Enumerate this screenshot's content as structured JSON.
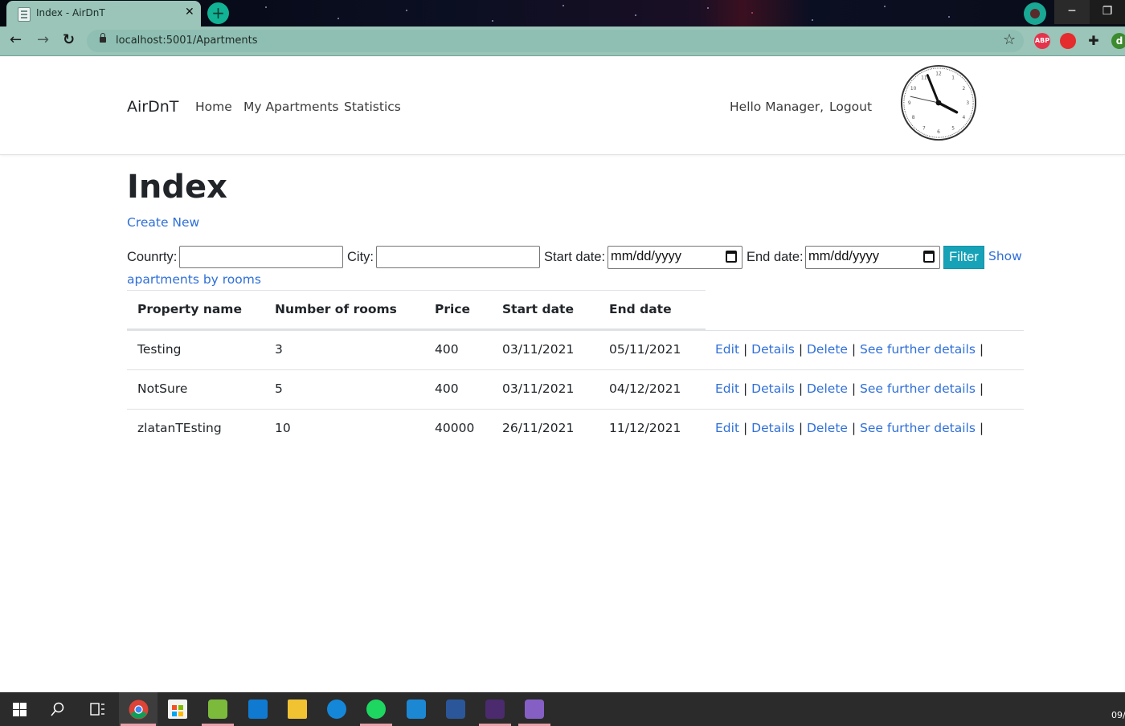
{
  "browser": {
    "tab_title": "Index - AirDnT",
    "tab_close": "✕",
    "new_tab": "+",
    "url": "localhost:5001/Apartments",
    "back": "←",
    "forward": "→",
    "reload": "↻",
    "bookmark": "☆",
    "extensions": [
      {
        "name": "ABP",
        "color": "#e5334b"
      },
      {
        "name": "",
        "color": "#e52d2d"
      },
      {
        "name": "",
        "color": "#1f1f1f"
      },
      {
        "name": "d",
        "color": "#3c8b2f"
      }
    ],
    "minimize": "─",
    "restore": "❐"
  },
  "navbar": {
    "brand": "AirDnT",
    "links": [
      "Home",
      "My Apartments",
      "Statistics"
    ],
    "greeting": "Hello Manager,",
    "logout": "Logout",
    "clock_numbers": [
      "12",
      "1",
      "2",
      "3",
      "4",
      "5",
      "6",
      "7",
      "8",
      "9",
      "10",
      "11"
    ]
  },
  "page": {
    "title": "Index",
    "create_new": "Create New",
    "filters": {
      "country_label": "Counrty:",
      "city_label": "City:",
      "start_date_label": "Start date:",
      "start_date_value": "mm/dd/yyyy",
      "end_date_label": "End date:",
      "end_date_value": "mm/dd/yyyy",
      "filter_button": "Filter",
      "show_link_part1": "Show",
      "show_link_part2": "apartments by rooms"
    },
    "table": {
      "headers": [
        "Property name",
        "Number of rooms",
        "Price",
        "Start date",
        "End date"
      ],
      "rows": [
        {
          "name": "Testing",
          "rooms": "3",
          "price": "400",
          "start": "03/11/2021",
          "end": "05/11/2021"
        },
        {
          "name": "NotSure",
          "rooms": "5",
          "price": "400",
          "start": "03/11/2021",
          "end": "04/12/2021"
        },
        {
          "name": "zlatanTEsting",
          "rooms": "10",
          "price": "40000",
          "start": "26/11/2021",
          "end": "11/12/2021"
        }
      ],
      "actions": {
        "edit": "Edit",
        "details": "Details",
        "delete": "Delete",
        "further": "See further details",
        "sep": "|"
      }
    }
  },
  "taskbar": {
    "date": "09/"
  }
}
